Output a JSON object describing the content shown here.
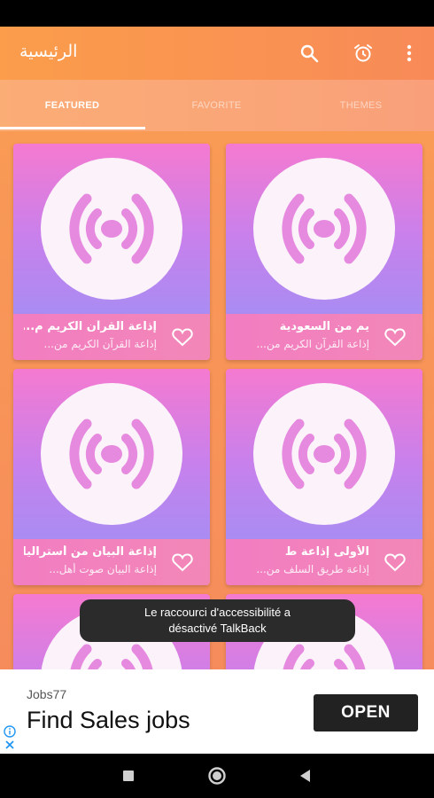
{
  "app_bar": {
    "title": "الرئيسية",
    "icons": [
      "search-icon",
      "alarm-icon",
      "more-vert-icon"
    ]
  },
  "tabs": [
    {
      "label": "FEATURED",
      "active": true
    },
    {
      "label": "FAVORITE",
      "active": false
    },
    {
      "label": "THEMES",
      "active": false
    }
  ],
  "cards": [
    {
      "title": "إذاعة القرآن الكريم م...",
      "subtitle": "إذاعة القرآن الكريم من...",
      "favorite": false
    },
    {
      "title": "يم من السعودية",
      "subtitle": "إذاعة القرآن الكريم من...",
      "favorite": false
    },
    {
      "title": "إذاعة البيان من أستراليا",
      "subtitle": "إذاعة البيان صوت أهل...",
      "favorite": false
    },
    {
      "title": "الأولى          إذاعة ط",
      "subtitle": "إذاعة طريق السلف من...",
      "favorite": false
    },
    {
      "title": "",
      "subtitle": "",
      "favorite": false
    },
    {
      "title": "",
      "subtitle": "",
      "favorite": false
    }
  ],
  "toast": {
    "line1": "Le raccourci d'accessibilité a",
    "line2": "désactivé TalkBack"
  },
  "ad": {
    "brand": "Jobs77",
    "headline": "Find Sales jobs",
    "cta": "OPEN"
  },
  "colors": {
    "accent": "#f88a58",
    "card_gradient_top": "#f57ad0",
    "card_gradient_bottom": "#a98cf2",
    "card_footer": "#f27dc2"
  }
}
